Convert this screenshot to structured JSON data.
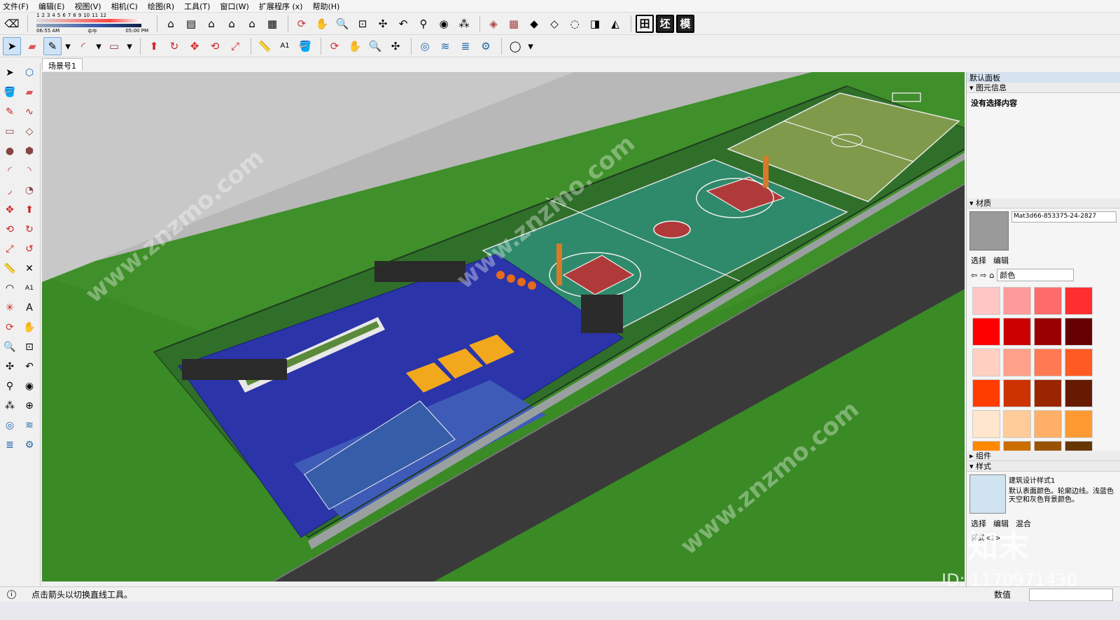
{
  "menu": [
    "文件(F)",
    "编辑(E)",
    "视图(V)",
    "相机(C)",
    "绘图(R)",
    "工具(T)",
    "窗口(W)",
    "扩展程序 (x)",
    "帮助(H)"
  ],
  "shadow": {
    "months": [
      "1",
      "2",
      "3",
      "4",
      "5",
      "6",
      "7",
      "8",
      "9",
      "10",
      "11",
      "12"
    ],
    "time_start": "06:55 AM",
    "time_mid": "中午",
    "time_end": "05:00 PM"
  },
  "toolbar_text_buttons": [
    "田",
    "坯",
    "模"
  ],
  "scene_tab": "场景号1",
  "tray": {
    "title": "默认面板",
    "entity_info": "图元信息",
    "no_selection": "没有选择内容",
    "materials": "材质",
    "material_name": "Mat3d66-853375-24-2827",
    "tab_select": "选择",
    "tab_edit": "编辑",
    "color_set": "颜色",
    "components": "组件",
    "styles": "样式",
    "style_name": "建筑设计样式1",
    "style_desc": "默认表面颜色。轮廓边线。浅蓝色天空和灰色背景颜色。",
    "style_tab_select": "选择",
    "style_tab_edit": "编辑",
    "style_tab_mix": "混合",
    "style_combo": "样式<1>"
  },
  "swatches": [
    "#ffc6c6",
    "#ff9a9a",
    "#ff6b6b",
    "#ff2f2f",
    "#ff0000",
    "#cc0000",
    "#990000",
    "#660000",
    "#ffd0c2",
    "#ffa08a",
    "#ff7a52",
    "#ff5a22",
    "#ff3d00",
    "#cc3300",
    "#992600",
    "#661a00",
    "#ffe6cc",
    "#ffcc99",
    "#ffb066",
    "#ff9a33",
    "#ff8800",
    "#cc6d00",
    "#995200",
    "#663600"
  ],
  "status_text": "点击箭头以切换直线工具。",
  "measure_label": "数值",
  "watermark_id": "ID: 1170971430",
  "watermark_brand": "知末",
  "watermark_site": "www.znzmo.com"
}
